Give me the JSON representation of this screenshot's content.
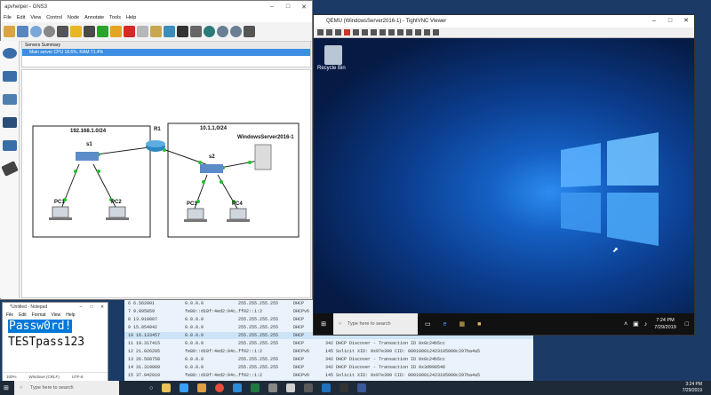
{
  "gns3": {
    "title": "apvhelper - GNS3",
    "menu": [
      "File",
      "Edit",
      "View",
      "Control",
      "Node",
      "Annotate",
      "Tools",
      "Help"
    ],
    "servers_summary_title": "Servers Summary",
    "server_status": "Main server CPU 18.6%, RAM 71.4%",
    "topology": {
      "net_left": "192.168.1.0/24",
      "net_right": "10.1.1.0/24",
      "router": "R1",
      "switch_left": "s1",
      "switch_right": "s2",
      "server": "WindowsServer2016-1",
      "pc1": "PC1",
      "pc2": "PC2",
      "pc3": "PC3",
      "pc4": "PC4"
    }
  },
  "notepad": {
    "title": "*Untitled - Notepad",
    "menu": [
      "File",
      "Edit",
      "Format",
      "View",
      "Help"
    ],
    "line1": "Passw0rd!",
    "line2": "TESTpass123",
    "status_zoom": "100%",
    "status_eol": "Windows (CRLF)",
    "status_enc": "UTF-8"
  },
  "vnc": {
    "title": "QEMU (WindowsServer2016-1) - TightVNC Viewer",
    "recycle_bin": "Recycle Bin",
    "search_placeholder": "Type here to search",
    "time": "7:24 PM",
    "date": "7/29/2019"
  },
  "packets": [
    {
      "no": "6 6.562001",
      "src": "0.0.0.0",
      "dst": "255.255.255.255",
      "proto": "DHCP",
      "info": ""
    },
    {
      "no": "7 9.895859",
      "src": "fe80::d10f:4ed2:04c…",
      "dst": "ff02::1:2",
      "proto": "DHCPv6",
      "info": ""
    },
    {
      "no": "8 13.910807",
      "src": "0.0.0.0",
      "dst": "255.255.255.255",
      "proto": "DHCP",
      "info": ""
    },
    {
      "no": "9 15.054942",
      "src": "0.0.0.0",
      "dst": "255.255.255.255",
      "proto": "DHCP",
      "info": ""
    },
    {
      "no": "10 16.133457",
      "src": "0.0.0.0",
      "dst": "255.255.255.255",
      "proto": "DHCP",
      "info": ""
    },
    {
      "no": "11 19.317415",
      "src": "0.0.0.0",
      "dst": "255.255.255.255",
      "proto": "DHCP",
      "info": "342 DHCP Discover - Transaction ID 0x8c24b5cc"
    },
    {
      "no": "12 21.026205",
      "src": "fe80::d10f:4ed2:04c…",
      "dst": "ff02::1:2",
      "proto": "DHCPv6",
      "info": "145 Solicit XID: 0x97e399 CID: 000100012423105000c297ba4a5"
    },
    {
      "no": "13 26.568758",
      "src": "0.0.0.0",
      "dst": "255.255.255.255",
      "proto": "DHCP",
      "info": "342 DHCP Discover - Transaction ID 0x8c24b5cc"
    },
    {
      "no": "14 31.319089",
      "src": "0.0.0.0",
      "dst": "255.255.255.255",
      "proto": "DHCP",
      "info": "342 DHCP Discover - Transaction ID 0x3d998546"
    },
    {
      "no": "15 37.942010",
      "src": "fe80::d10f:4ed2:04c…",
      "dst": "ff02::1:2",
      "proto": "DHCPv6",
      "info": "145 Solicit XID: 0x97e399 CID: 000100012423105000c297ba4a5"
    }
  ],
  "taskbar": {
    "search_placeholder": "Type here to search",
    "time": "3:24 PM",
    "date": "7/29/2019"
  },
  "colors": {
    "selection_blue": "#0078d7",
    "server_row_blue": "#3d8ee2",
    "desktop_blue": "#1560c4",
    "link_green": "#22c02a"
  }
}
